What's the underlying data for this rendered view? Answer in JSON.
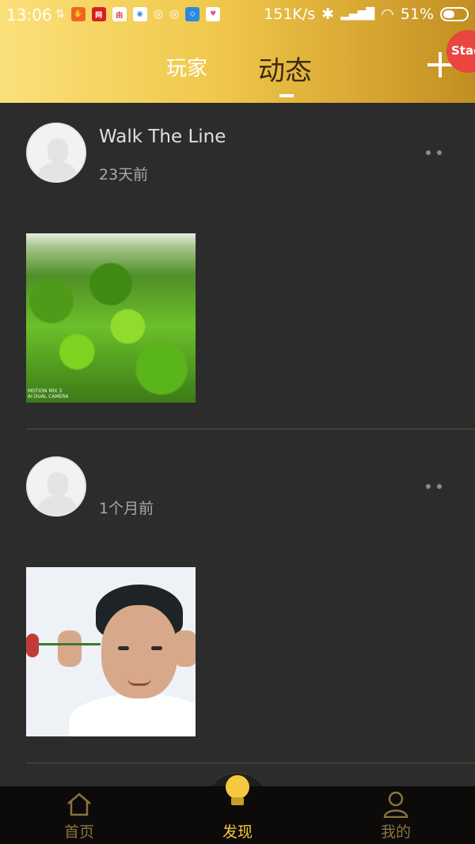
{
  "status_bar": {
    "time": "13:06",
    "network_speed": "151K/s",
    "battery": "51%"
  },
  "header": {
    "tabs": [
      {
        "label": "玩家",
        "active": false
      },
      {
        "label": "动态",
        "active": true
      }
    ],
    "badge_text": "Stac",
    "accent": "#f0c84c"
  },
  "posts": [
    {
      "username": "Walk The Line",
      "time_ago": "23天前",
      "photo_icon": "forest-photo",
      "photo_caption": "MOTION MIX 3\nAI DUAL CAMERA"
    },
    {
      "username": "",
      "time_ago": "1个月前",
      "photo_icon": "portrait-photo"
    }
  ],
  "bottom_nav": {
    "items": [
      {
        "label": "首页",
        "icon": "home-icon",
        "active": false
      },
      {
        "label": "发现",
        "icon": "lightbulb-icon",
        "active": true
      },
      {
        "label": "我的",
        "icon": "person-icon",
        "active": false
      }
    ],
    "active_color": "#f5c93f",
    "inactive_color": "#8a7240"
  }
}
